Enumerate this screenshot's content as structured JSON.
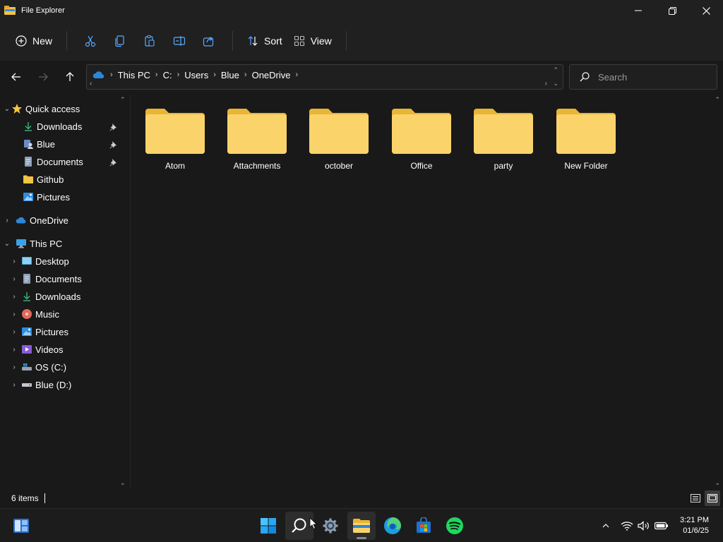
{
  "window": {
    "title": "File Explorer"
  },
  "commandbar": {
    "new_label": "New",
    "sort_label": "Sort",
    "view_label": "View"
  },
  "address": {
    "crumbs": [
      "This PC",
      "C:",
      "Users",
      "Blue",
      "OneDrive"
    ]
  },
  "search": {
    "placeholder": "Search"
  },
  "navpane": {
    "quick_access": "Quick access",
    "quick_items": [
      "Downloads",
      "Blue",
      "Documents",
      "Github",
      "Pictures"
    ],
    "onedrive": "OneDrive",
    "this_pc": "This PC",
    "pc_items": [
      "Desktop",
      "Documents",
      "Downloads",
      "Music",
      "Pictures",
      "Videos",
      "OS (C:)",
      "Blue (D:)"
    ]
  },
  "content": {
    "folders": [
      "Atom",
      "Attachments",
      "october",
      "Office",
      "party",
      "New Folder"
    ]
  },
  "status": {
    "item_count": "6 items"
  },
  "taskbar": {
    "time": "3:21 PM",
    "date": "01/6/25"
  },
  "colors": {
    "accent": "#0078d4",
    "folder_yellow": "#f8c94a",
    "background": "#191919"
  }
}
